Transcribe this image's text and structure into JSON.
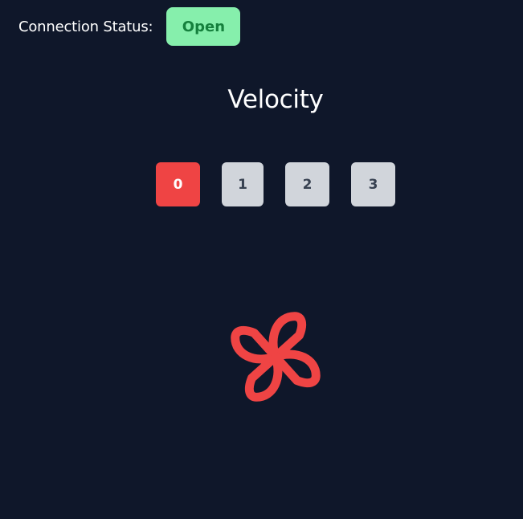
{
  "connection": {
    "label": "Connection Status:",
    "status": "Open",
    "status_bg": "#86efac",
    "status_color": "#15803d"
  },
  "title": "Velocity",
  "speeds": {
    "active_index": 0,
    "active_color": "#ef4444",
    "inactive_color": "#d1d5db",
    "options": [
      "0",
      "1",
      "2",
      "3"
    ]
  },
  "fan": {
    "icon": "fan-icon",
    "color": "#ef4444"
  },
  "background": "#0f172a"
}
